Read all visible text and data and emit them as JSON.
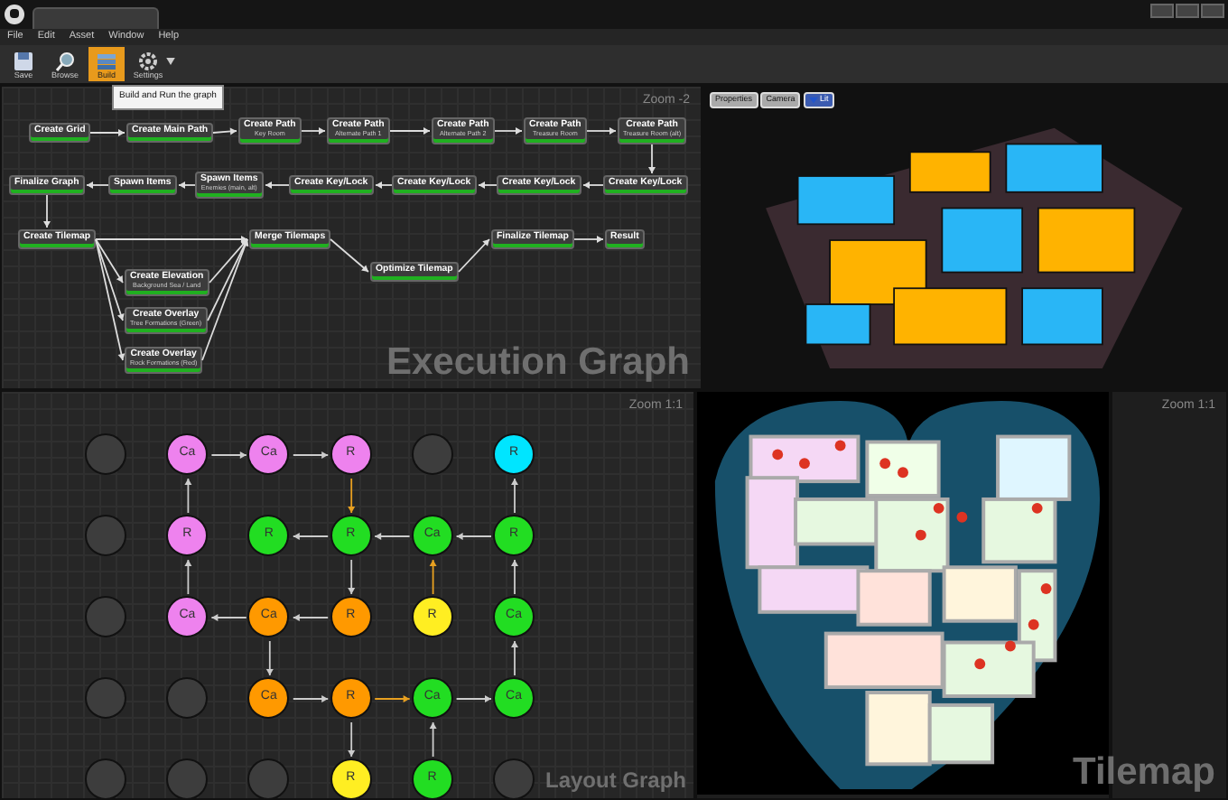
{
  "menu": [
    "File",
    "Edit",
    "Asset",
    "Window",
    "Help"
  ],
  "toolbar": {
    "buttons": [
      {
        "label": "Save",
        "kind": "save",
        "selected": false
      },
      {
        "label": "Browse",
        "kind": "browse",
        "selected": false
      },
      {
        "label": "Build",
        "kind": "build",
        "selected": true
      },
      {
        "label": "Settings",
        "kind": "settings",
        "selected": false
      }
    ],
    "tooltip": "Build and Run the graph"
  },
  "execution_graph": {
    "title": "Execution Graph",
    "zoom": "Zoom -2",
    "nodes": [
      {
        "label": "Create Grid"
      },
      {
        "label": "Create Main Path"
      },
      {
        "label": "Create Path",
        "subtitle": "Key Room"
      },
      {
        "label": "Create Path",
        "subtitle": "Alternate Path 1"
      },
      {
        "label": "Create Path",
        "subtitle": "Alternate Path 2"
      },
      {
        "label": "Create Path",
        "subtitle": "Treasure Room"
      },
      {
        "label": "Create Path",
        "subtitle": "Treasure Room (alt)"
      },
      {
        "label": "Finalize Graph"
      },
      {
        "label": "Spawn Items"
      },
      {
        "label": "Spawn Items",
        "subtitle": "Enemies (main, alt)"
      },
      {
        "label": "Create Key/Lock"
      },
      {
        "label": "Create Key/Lock"
      },
      {
        "label": "Create Key/Lock"
      },
      {
        "label": "Create Key/Lock"
      },
      {
        "label": "Create Tilemap"
      },
      {
        "label": "Merge Tilemaps"
      },
      {
        "label": "Optimize Tilemap"
      },
      {
        "label": "Create Elevation",
        "subtitle": "Background Sea / Land"
      },
      {
        "label": "Create Overlay",
        "subtitle": "Tree Formations (Green)"
      },
      {
        "label": "Create Overlay",
        "subtitle": "Rock Formations (Red)"
      },
      {
        "label": "Finalize Tilemap"
      },
      {
        "label": "Result"
      }
    ]
  },
  "viewport": {
    "buttons": [
      "Properties",
      "Camera",
      "Lit"
    ]
  },
  "layout_graph": {
    "title": "Layout Graph",
    "zoom": "Zoom 1:1",
    "cells": [
      {
        "kind": "empty"
      },
      {
        "kind": "room",
        "label": "Ca",
        "color": "#ee82ee"
      },
      {
        "kind": "room",
        "label": "Ca",
        "color": "#ee82ee"
      },
      {
        "kind": "room",
        "label": "R",
        "color": "#ee82ee"
      },
      {
        "kind": "empty"
      },
      {
        "kind": "room",
        "label": "R",
        "color": "#00e5ff"
      },
      {
        "kind": "empty"
      },
      {
        "kind": "room",
        "label": "R",
        "color": "#ee82ee"
      },
      {
        "kind": "room",
        "label": "R",
        "color": "#22dd22"
      },
      {
        "kind": "room",
        "label": "R",
        "color": "#22dd22"
      },
      {
        "kind": "room",
        "label": "Ca",
        "color": "#22dd22"
      },
      {
        "kind": "room",
        "label": "R",
        "color": "#22dd22"
      },
      {
        "kind": "empty"
      },
      {
        "kind": "room",
        "label": "Ca",
        "color": "#ee82ee"
      },
      {
        "kind": "room",
        "label": "Ca",
        "color": "#ff9900"
      },
      {
        "kind": "room",
        "label": "R",
        "color": "#ff9900"
      },
      {
        "kind": "room",
        "label": "R",
        "color": "#ffee22"
      },
      {
        "kind": "room",
        "label": "Ca",
        "color": "#22dd22"
      },
      {
        "kind": "empty"
      },
      {
        "kind": "empty"
      },
      {
        "kind": "room",
        "label": "Ca",
        "color": "#ff9900"
      },
      {
        "kind": "room",
        "label": "R",
        "color": "#ff9900"
      },
      {
        "kind": "room",
        "label": "Ca",
        "color": "#22dd22"
      },
      {
        "kind": "room",
        "label": "Ca",
        "color": "#22dd22"
      },
      {
        "kind": "empty"
      },
      {
        "kind": "empty"
      },
      {
        "kind": "empty"
      },
      {
        "kind": "room",
        "label": "R",
        "color": "#ffee22"
      },
      {
        "kind": "room",
        "label": "R",
        "color": "#22dd22"
      },
      {
        "kind": "empty"
      }
    ]
  },
  "tilemap": {
    "title": "Tilemap",
    "zoom": "Zoom 1:1"
  }
}
